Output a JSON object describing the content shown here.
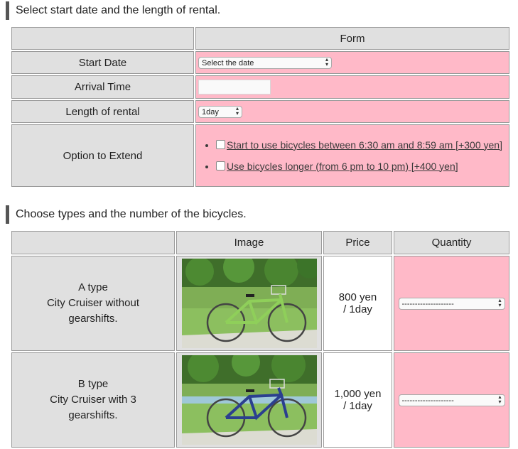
{
  "section1": {
    "heading": "Select start date and the length of rental.",
    "form_header": "Form",
    "rows": {
      "start_date": {
        "label": "Start Date",
        "select_value": "Select the date"
      },
      "arrival_time": {
        "label": "Arrival Time",
        "input_value": ""
      },
      "length": {
        "label": "Length of rental",
        "select_value": "1day"
      },
      "extend": {
        "label": "Option to Extend",
        "option1": "Start to use bicycles between 6:30 am and 8:59 am [+300 yen]",
        "option2": "Use bicycles longer (from 6 pm to 10 pm) [+400 yen]"
      }
    }
  },
  "section2": {
    "heading": "Choose types and the number of the bicycles.",
    "headers": {
      "image": "Image",
      "price": "Price",
      "quantity": "Quantity"
    },
    "bikes": [
      {
        "type": "A type",
        "desc": "City Cruiser without gearshifts.",
        "price": "800 yen",
        "per": "/ 1day",
        "quantity": "--------------------",
        "frame_color": "#8fcf5a"
      },
      {
        "type": "B type",
        "desc": "City Cruiser with 3 gearshifts.",
        "price": "1,000 yen",
        "per": "/ 1day",
        "quantity": "--------------------",
        "frame_color": "#2b3f8f"
      }
    ]
  }
}
